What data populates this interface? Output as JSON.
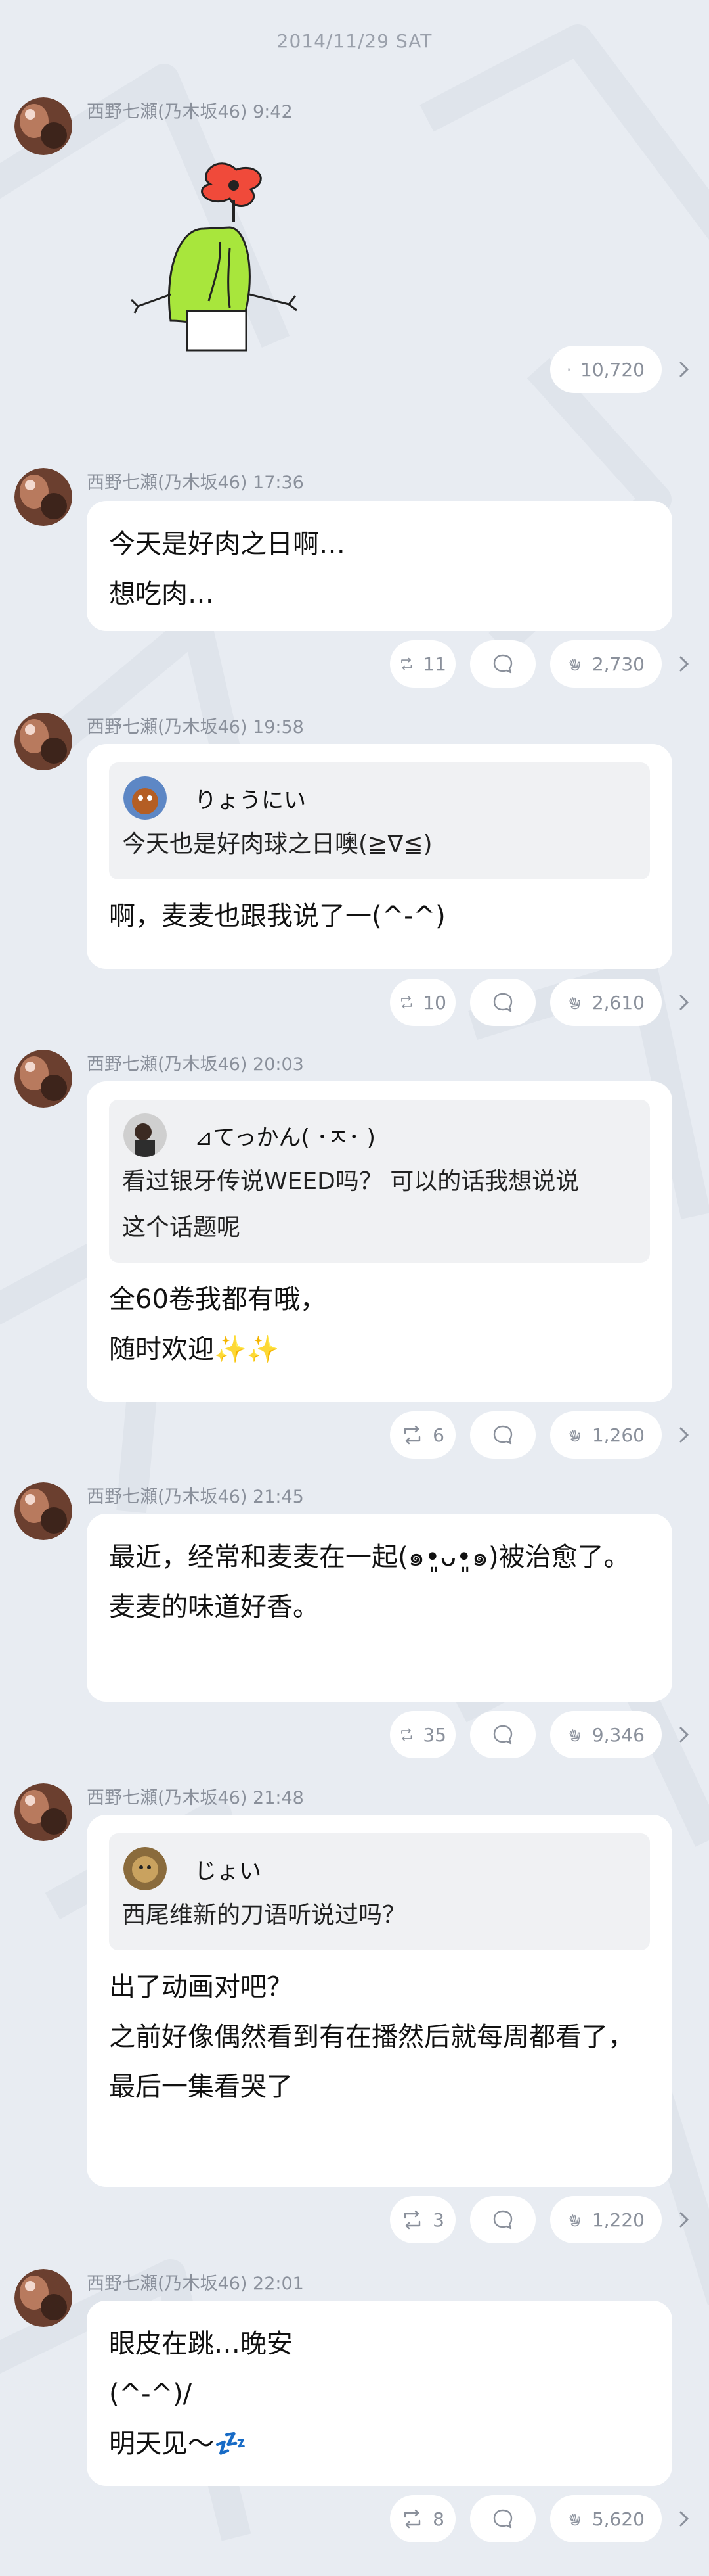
{
  "date_header": "2014/11/29 SAT",
  "sender": "西野七瀬(乃木坂46)",
  "posts": [
    {
      "time": "9:42",
      "type": "sticker",
      "likes": "10,720"
    },
    {
      "time": "17:36",
      "lines": [
        "今天是好肉之日啊…",
        "想吃肉…"
      ],
      "retweets": "11",
      "likes": "2,730"
    },
    {
      "time": "19:58",
      "quote": {
        "name": "りょうにい",
        "lines": [
          "今天也是好肉球之日噢(≧∇≦)"
        ]
      },
      "lines": [
        "啊，麦麦也跟我说了一(^-^)"
      ],
      "retweets": "10",
      "likes": "2,610"
    },
    {
      "time": "20:03",
      "quote": {
        "name": "⊿てっかん( ･ㅈ･ )",
        "lines": [
          "看过银牙传说WEED吗？ 可以的话我想说说",
          "这个话题呢"
        ]
      },
      "lines": [
        "全60卷我都有哦，",
        "随时欢迎✨✨"
      ],
      "retweets": "6",
      "likes": "1,260"
    },
    {
      "time": "21:45",
      "lines": [
        "最近，经常和麦麦在一起(๑•͈ᴗ•͈๑)被治愈了。",
        "麦麦的味道好香。"
      ],
      "retweets": "35",
      "likes": "9,346"
    },
    {
      "time": "21:48",
      "quote": {
        "name": "じょい",
        "lines": [
          "西尾维新的刀语听说过吗？"
        ]
      },
      "lines": [
        "出了动画对吧？",
        "之前好像偶然看到有在播然后就每周都看了，",
        "最后一集看哭了"
      ],
      "retweets": "3",
      "likes": "1,220"
    },
    {
      "time": "22:01",
      "lines": [
        "眼皮在跳…晚安",
        "(^-^)/",
        "明天见〜💤"
      ],
      "retweets": "8",
      "likes": "5,620"
    }
  ],
  "colors": {
    "background": "#e8ecf2",
    "bubble": "#ffffff",
    "meta_text": "#8a909b",
    "quote_bg": "#f0f1f3"
  },
  "icons": {
    "retweet": "retweet-icon",
    "comment": "comment-icon",
    "like": "clap-icon",
    "more": "chevron-right-icon"
  }
}
